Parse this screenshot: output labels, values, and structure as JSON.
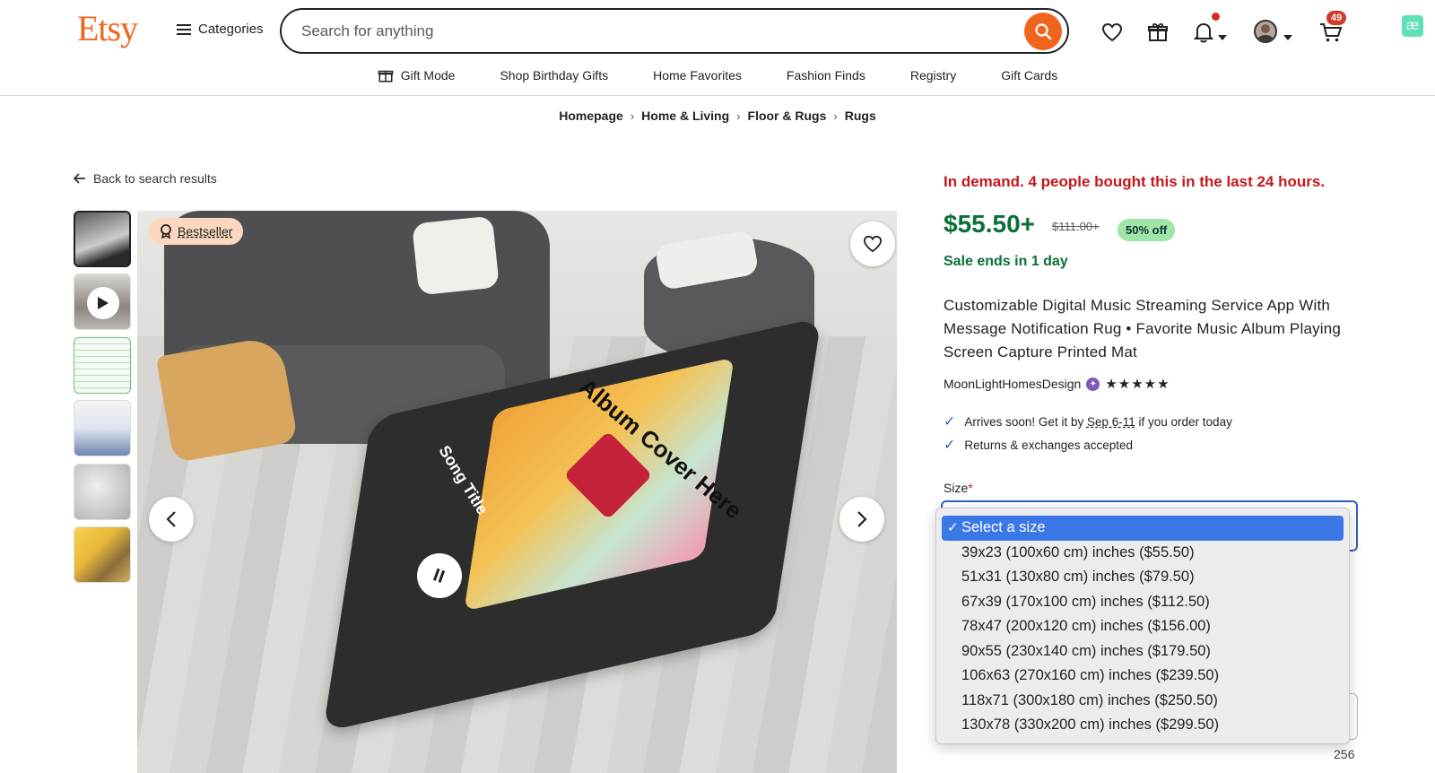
{
  "header": {
    "logo": "Etsy",
    "categories_label": "Categories",
    "search_placeholder": "Search for anything",
    "cart_count": "49"
  },
  "nav": [
    {
      "label": "Gift Mode",
      "icon": "gift-icon"
    },
    {
      "label": "Shop Birthday Gifts"
    },
    {
      "label": "Home Favorites"
    },
    {
      "label": "Fashion Finds"
    },
    {
      "label": "Registry"
    },
    {
      "label": "Gift Cards"
    }
  ],
  "breadcrumbs": [
    "Homepage",
    "Home & Living",
    "Floor & Rugs",
    "Rugs"
  ],
  "back_link": "Back to search results",
  "gallery": {
    "badge": "Bestseller",
    "image_text": {
      "album": "Album Cover Here",
      "song": "Song Title"
    }
  },
  "product": {
    "demand": "In demand. 4 people bought this in the last 24 hours.",
    "price": "$55.50+",
    "original_price": "$111.00+",
    "discount": "50% off",
    "sale_ends": "Sale ends in 1 day",
    "title": "Customizable Digital Music Streaming Service App With Message Notification Rug • Favorite Music Album Playing Screen Capture Printed Mat",
    "shop_name": "MoonLightHomesDesign",
    "stars": "★★★★★",
    "shipping_prefix": "Arrives soon! Get it by ",
    "shipping_dates": "Sep 6-11",
    "shipping_suffix": " if you order today",
    "returns": "Returns & exchanges accepted",
    "size_label": "Size",
    "required_mark": "*",
    "char_count": "256"
  },
  "size_options": [
    "Select a size",
    "39x23 (100x60 cm) inches ($55.50)",
    "51x31 (130x80 cm) inches ($79.50)",
    "67x39 (170x100 cm) inches ($112.50)",
    "78x47 (200x120 cm) inches ($156.00)",
    "90x55 (230x140 cm) inches ($179.50)",
    "106x63 (270x160 cm) inches ($239.50)",
    "118x71 (300x180 cm) inches ($250.50)",
    "130x78 (330x200 cm) inches ($299.50)"
  ],
  "colors": {
    "brand": "#f1641e",
    "sale_green": "#0a6f37",
    "alert_red": "#c7161a",
    "select_blue": "#3b78e7"
  }
}
